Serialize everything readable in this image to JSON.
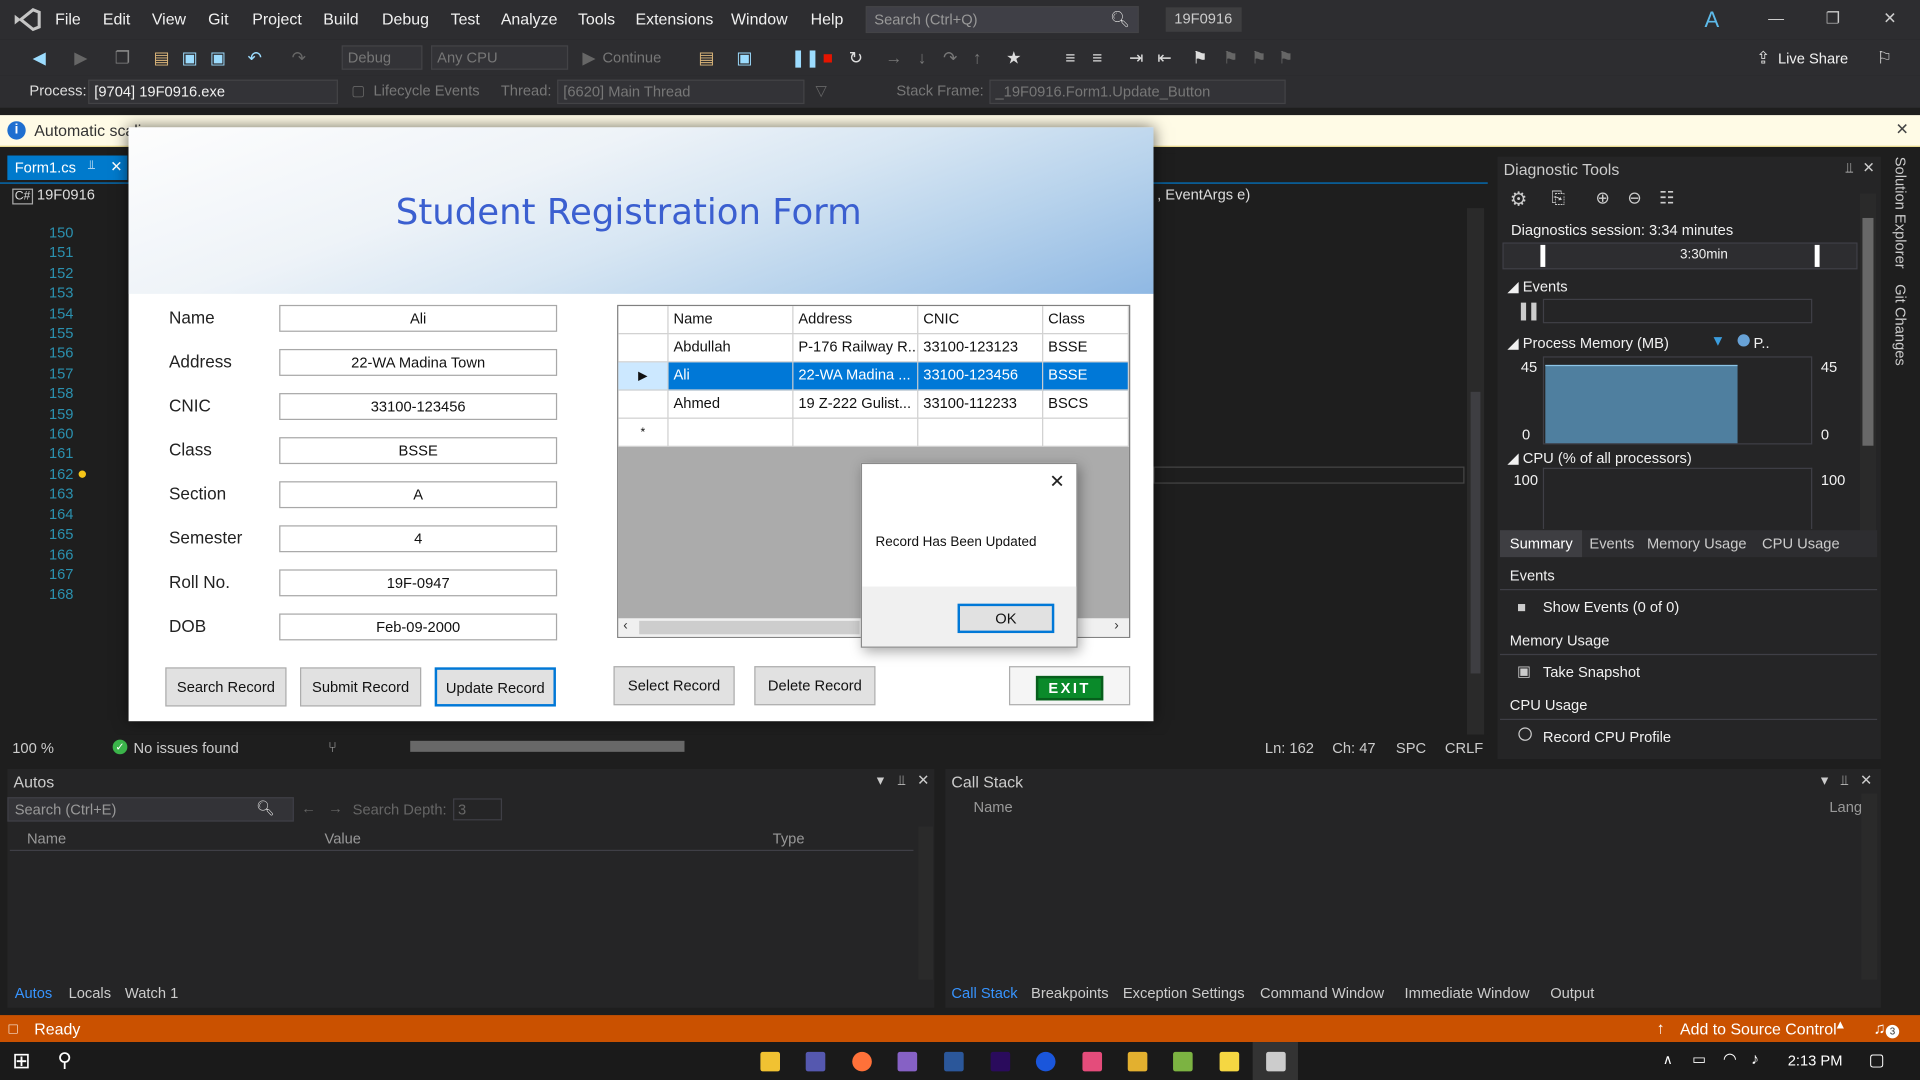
{
  "menubar": {
    "items": [
      "File",
      "Edit",
      "View",
      "Git",
      "Project",
      "Build",
      "Debug",
      "Test",
      "Analyze",
      "Tools",
      "Extensions",
      "Window",
      "Help"
    ],
    "search_placeholder": "Search (Ctrl+Q)",
    "solution_name": "19F0916",
    "avatar_letter": "A"
  },
  "toolbar": {
    "config": "Debug",
    "platform": "Any CPU",
    "continue_label": "Continue",
    "live_share": "Live Share"
  },
  "processbar": {
    "process_label": "Process:",
    "process_value": "[9704] 19F0916.exe",
    "lifecycle_label": "Lifecycle Events",
    "thread_label": "Thread:",
    "thread_value": "[6620] Main Thread",
    "stackframe_label": "Stack Frame:",
    "stackframe_value": "_19F0916.Form1.Update_Button"
  },
  "infobar": {
    "text": "Automatic scali..."
  },
  "editor": {
    "tab_name": "Form1.cs",
    "nav_project": "19F0916",
    "nav_method": ", EventArgs e)",
    "line_numbers": [
      "150",
      "151",
      "152",
      "153",
      "154",
      "155",
      "156",
      "157",
      "158",
      "159",
      "160",
      "161",
      "162",
      "163",
      "164",
      "165",
      "166",
      "167",
      "168"
    ],
    "zoom": "100 %",
    "issues": "No issues found",
    "line": "Ln: 162",
    "col": "Ch: 47",
    "spacing": "SPC",
    "line_ending": "CRLF"
  },
  "form": {
    "title": "Student Registration Form",
    "fields": [
      {
        "label": "Name",
        "value": "Ali"
      },
      {
        "label": "Address",
        "value": "22-WA Madina Town"
      },
      {
        "label": "CNIC",
        "value": "33100-123456"
      },
      {
        "label": "Class",
        "value": "BSSE"
      },
      {
        "label": "Section",
        "value": "A"
      },
      {
        "label": "Semester",
        "value": "4"
      },
      {
        "label": "Roll No.",
        "value": "19F-0947"
      },
      {
        "label": "DOB",
        "value": "Feb-09-2000"
      }
    ],
    "grid": {
      "columns": [
        "Name",
        "Address",
        "CNIC",
        "Class"
      ],
      "rows": [
        [
          "Abdullah",
          "P-176 Railway R...",
          "33100-123123",
          "BSSE"
        ],
        [
          "Ali",
          "22-WA Madina ...",
          "33100-123456",
          "BSSE"
        ],
        [
          "Ahmed",
          "19 Z-222 Gulist...",
          "33100-112233",
          "BSCS"
        ]
      ],
      "new_row_marker": "*"
    },
    "buttons": {
      "search": "Search Record",
      "submit": "Submit Record",
      "update": "Update Record",
      "select": "Select Record",
      "delete": "Delete Record",
      "exit": "EXIT"
    }
  },
  "messagebox": {
    "message": "Record Has Been Updated",
    "ok": "OK"
  },
  "diagnostics": {
    "title": "Diagnostic Tools",
    "session": "Diagnostics session: 3:34 minutes",
    "timeline_label": "3:30min",
    "events_label": "Events",
    "memory_label": "Process Memory (MB)",
    "memory_legend": "P..",
    "memory_max": "45",
    "memory_min": "0",
    "cpu_label": "CPU (% of all processors)",
    "cpu_max": "100",
    "tabs": [
      "Summary",
      "Events",
      "Memory Usage",
      "CPU Usage"
    ],
    "sections": {
      "events_title": "Events",
      "show_events": "Show Events (0 of 0)",
      "memory_title": "Memory Usage",
      "take_snapshot": "Take Snapshot",
      "cpu_title": "CPU Usage",
      "record_cpu": "Record CPU Profile"
    },
    "vertical_tabs": [
      "Solution Explorer",
      "Git Changes"
    ]
  },
  "autos": {
    "title": "Autos",
    "search_placeholder": "Search (Ctrl+E)",
    "search_depth_label": "Search Depth:",
    "search_depth": "3",
    "columns": [
      "Name",
      "Value",
      "Type"
    ],
    "tabs": [
      "Autos",
      "Locals",
      "Watch 1"
    ]
  },
  "callstack": {
    "title": "Call Stack",
    "columns": [
      "Name",
      "Lang"
    ],
    "tabs": [
      "Call Stack",
      "Breakpoints",
      "Exception Settings",
      "Command Window",
      "Immediate Window",
      "Output"
    ]
  },
  "statusbar": {
    "ready": "Ready",
    "source_control": "Add to Source Control",
    "notifications": "3"
  },
  "taskbar": {
    "time": "2:13 PM"
  },
  "colors": {
    "accent": "#007acc",
    "statusbar": "#ca5100",
    "selected_row": "#0078d7",
    "form_title": "#3b5fd0",
    "exit_green": "#0a8a2a"
  }
}
